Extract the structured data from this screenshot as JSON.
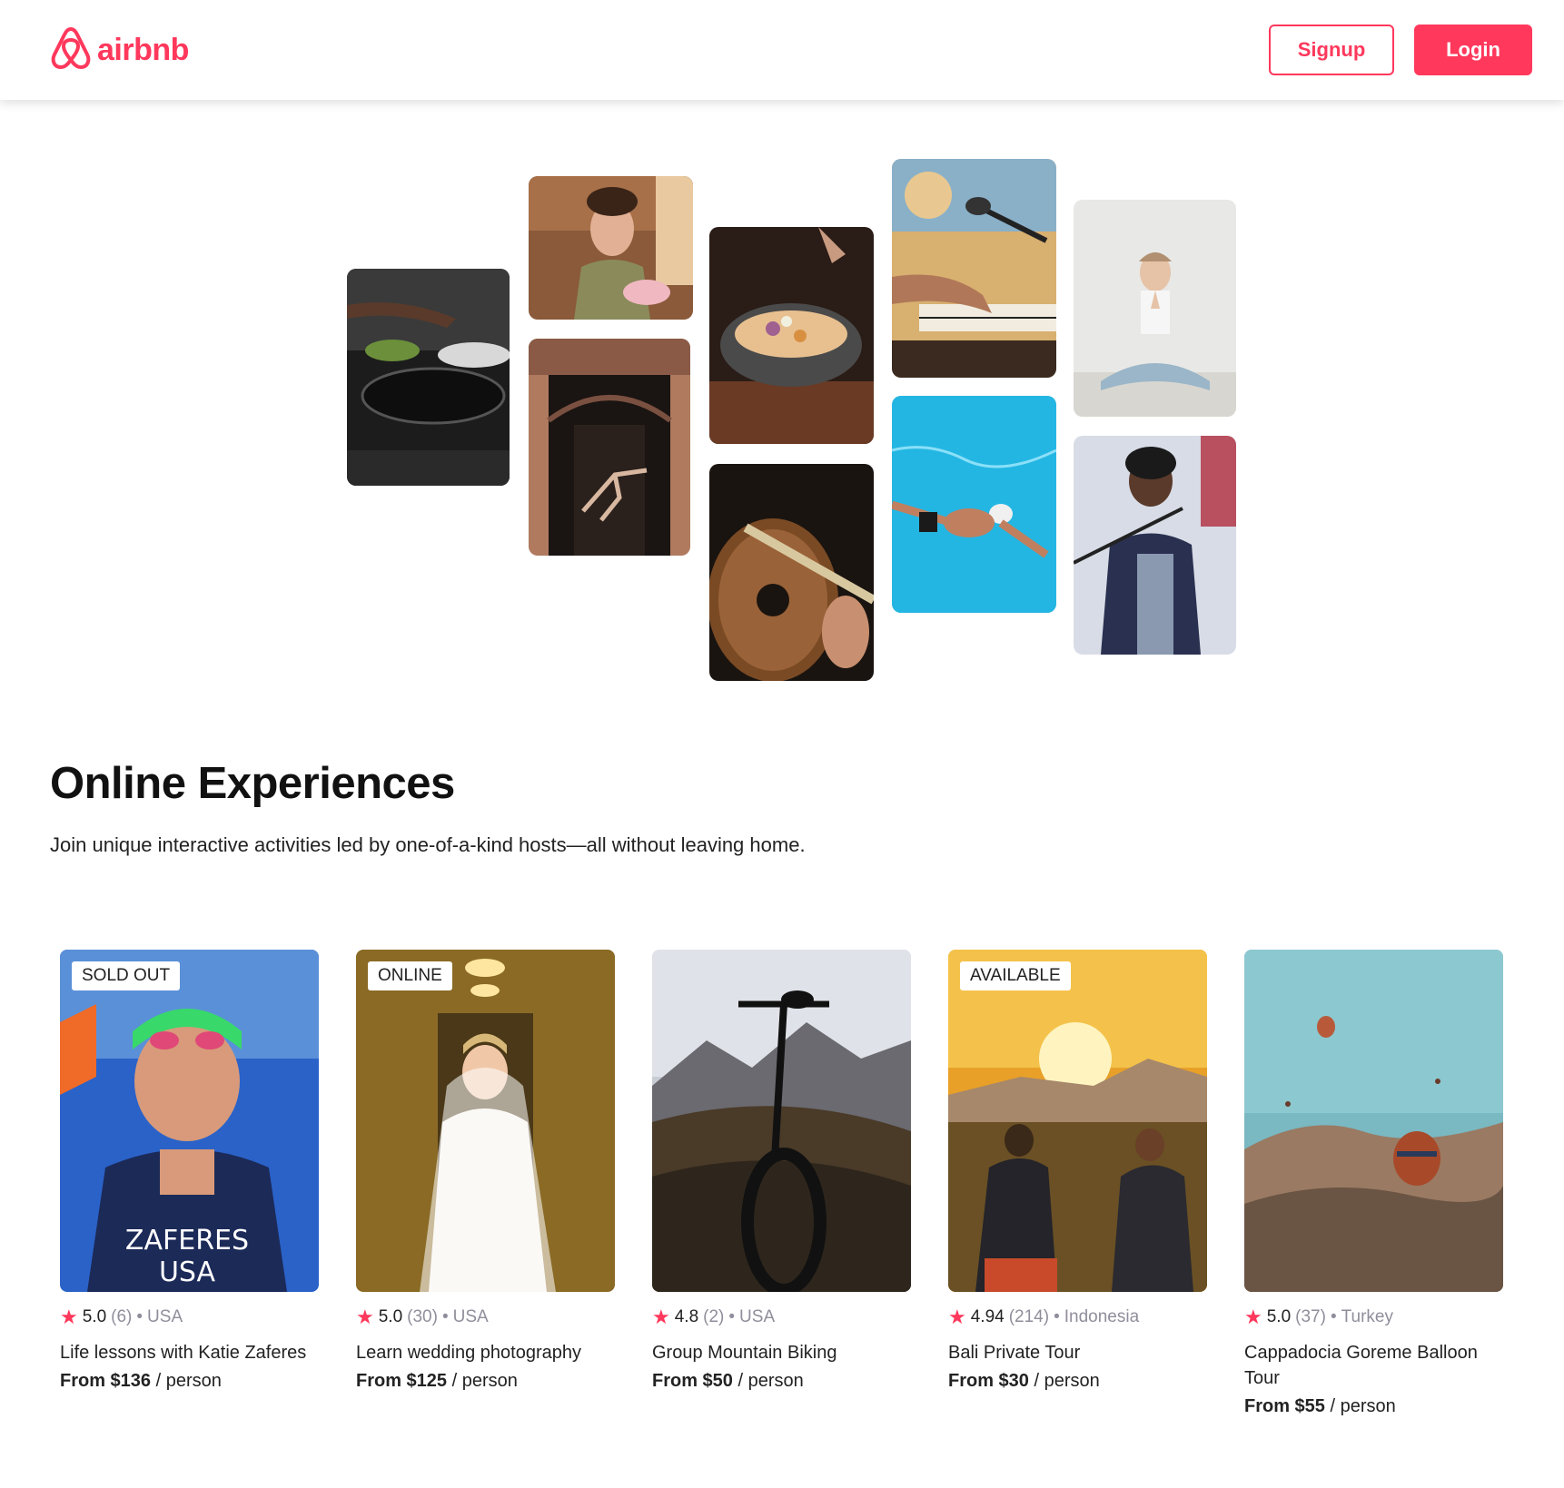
{
  "brand": {
    "name": "airbnb",
    "color": "#FF385C",
    "icon": "airbnb-belo-logo"
  },
  "nav": {
    "signup_label": "Signup",
    "login_label": "Login"
  },
  "hero": {
    "title": "Online Experiences",
    "subtitle": "Join unique interactive activities led by one-of-a-kind hosts—all without leaving home."
  },
  "gallery": [
    {
      "subject": "cooking-pans"
    },
    {
      "subject": "woman-holding-macarons"
    },
    {
      "subject": "dancer-in-doorway"
    },
    {
      "subject": "food-bowl-seasoning"
    },
    {
      "subject": "acoustic-guitar"
    },
    {
      "subject": "piano-and-microphone"
    },
    {
      "subject": "swimmer-in-pool"
    },
    {
      "subject": "woman-meditating"
    },
    {
      "subject": "singer-at-microphone"
    }
  ],
  "cards": [
    {
      "badge": "SOLD OUT",
      "rating": "5.0",
      "reviews": "(6)",
      "separator": "•",
      "location": "USA",
      "title": "Life lessons with Katie Zaferes",
      "price_prefix": "From $136",
      "price_suffix": " / person",
      "image": "triathlete-portrait"
    },
    {
      "badge": "ONLINE",
      "rating": "5.0",
      "reviews": "(30)",
      "separator": "•",
      "location": "USA",
      "title": "Learn wedding photography",
      "price_prefix": "From $125",
      "price_suffix": " / person",
      "image": "bride-in-hallway"
    },
    {
      "badge": "",
      "rating": "4.8",
      "reviews": "(2)",
      "separator": "•",
      "location": "USA",
      "title": "Group Mountain Biking",
      "price_prefix": "From $50",
      "price_suffix": " / person",
      "image": "mountain-bike"
    },
    {
      "badge": "AVAILABLE",
      "rating": "4.94",
      "reviews": "(214)",
      "separator": "•",
      "location": "Indonesia",
      "title": "Bali Private Tour",
      "price_prefix": "From $30",
      "price_suffix": " / person",
      "image": "sunrise-photographers"
    },
    {
      "badge": "",
      "rating": "5.0",
      "reviews": "(37)",
      "separator": "•",
      "location": "Turkey",
      "title": "Cappadocia Goreme Balloon Tour",
      "price_prefix": "From $55",
      "price_suffix": " / person",
      "image": "hot-air-balloons"
    }
  ]
}
